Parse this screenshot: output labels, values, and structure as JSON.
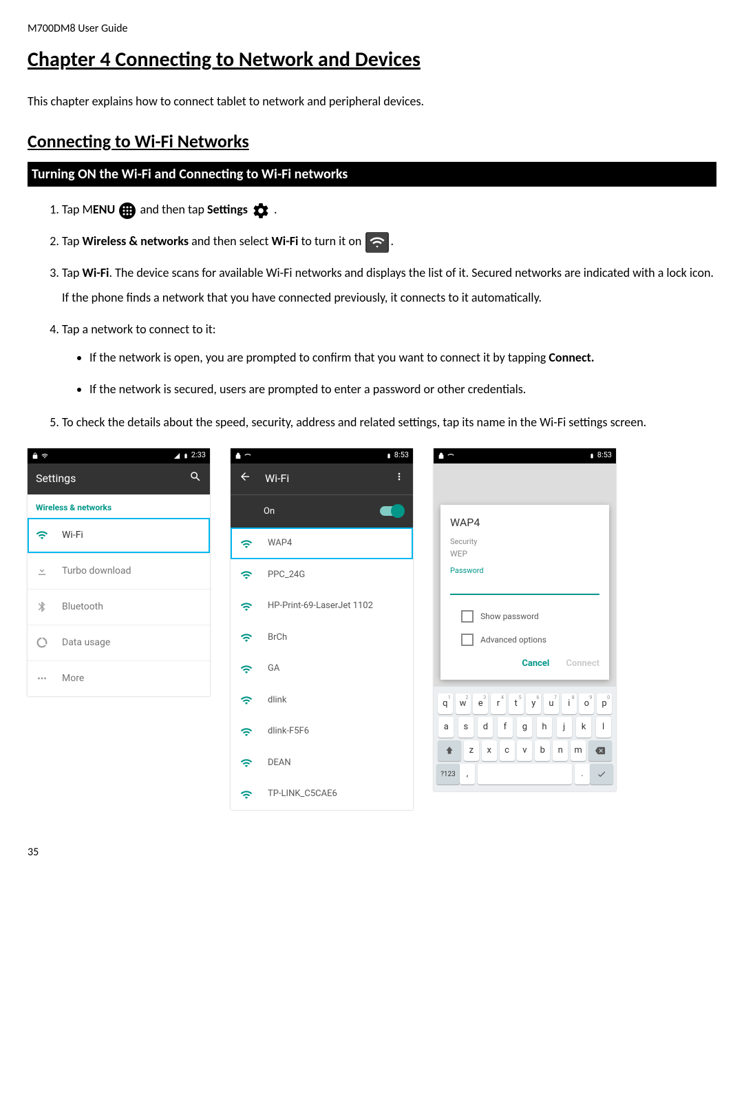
{
  "doc_header": "M700DM8 User Guide",
  "chapter_title": "Chapter 4 Connecting to Network and Devices",
  "intro_text": "This chapter explains how to connect tablet to network and peripheral devices.",
  "section_title": "Connecting to Wi-Fi Networks",
  "black_bar_text": "Turning ON the Wi-Fi and Connecting to Wi-Fi networks",
  "steps": {
    "s1_a": "Tap M",
    "s1_b": "ENU",
    "s1_c": " and then tap ",
    "s1_d": "Settings",
    "s1_e": " .",
    "s2_a": "Tap ",
    "s2_b": "Wireless & networks",
    "s2_c": " and then select ",
    "s2_d": "Wi-Fi",
    "s2_e": " to turn it on ",
    "s2_f": ".",
    "s3_a": "Tap ",
    "s3_b": "Wi-Fi",
    "s3_c": ". The device scans for available Wi-Fi networks and displays the list of it. Secured networks are indicated with a lock icon. If the phone finds a network that you have connected previously, it connects to it automatically.",
    "s4": "Tap a network to connect to it:",
    "s4_b1_a": "If the network is open, you are prompted to confirm that you want to connect it by tapping ",
    "s4_b1_b": "Connect.",
    "s4_b2": "If the network is secured, users are prompted to enter a password or other credentials.",
    "s5": "To check the details about the speed, security, address and related settings, tap its name in the Wi-Fi settings screen."
  },
  "screen1": {
    "time": "2:33",
    "title": "Settings",
    "category": "Wireless & networks",
    "rows": [
      "Wi-Fi",
      "Turbo download",
      "Bluetooth",
      "Data usage",
      "More"
    ]
  },
  "screen2": {
    "time": "8:53",
    "title": "Wi-Fi",
    "on_label": "On",
    "networks": [
      "WAP4",
      "PPC_24G",
      "HP-Print-69-LaserJet 1102",
      "BrCh",
      "GA",
      "dlink",
      "dlink-F5F6",
      "DEAN",
      "TP-LINK_C5CAE6"
    ]
  },
  "screen3": {
    "time": "8:53",
    "dialog": {
      "title": "WAP4",
      "security_label": "Security",
      "security_value": "WEP",
      "password_label": "Password",
      "show_password": "Show password",
      "advanced": "Advanced options",
      "cancel": "Cancel",
      "connect": "Connect"
    },
    "keyboard": {
      "row1": [
        {
          "k": "q",
          "h": "1"
        },
        {
          "k": "w",
          "h": "2"
        },
        {
          "k": "e",
          "h": "3"
        },
        {
          "k": "r",
          "h": "4"
        },
        {
          "k": "t",
          "h": "5"
        },
        {
          "k": "y",
          "h": "6"
        },
        {
          "k": "u",
          "h": "7"
        },
        {
          "k": "i",
          "h": "8"
        },
        {
          "k": "o",
          "h": "9"
        },
        {
          "k": "p",
          "h": "0"
        }
      ],
      "row2": [
        "a",
        "s",
        "d",
        "f",
        "g",
        "h",
        "j",
        "k",
        "l"
      ],
      "row3": [
        "z",
        "x",
        "c",
        "v",
        "b",
        "n",
        "m"
      ],
      "sym": "?123",
      "comma": ",",
      "period": "."
    }
  },
  "page_number": "35"
}
